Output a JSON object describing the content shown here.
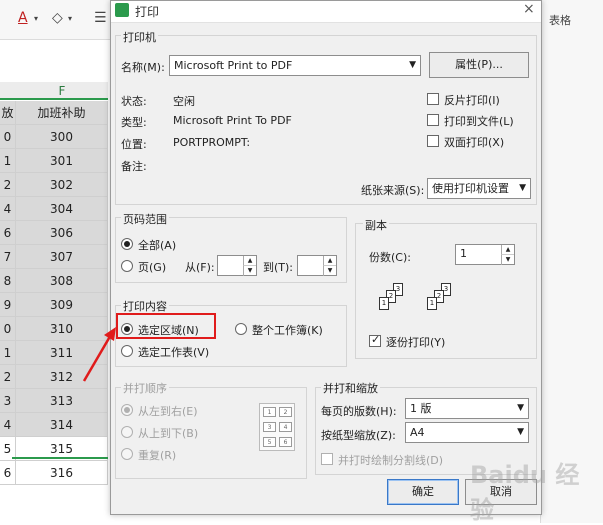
{
  "toolbar": {
    "font_color_icon": "A",
    "eraser_icon": "◇",
    "menu_icon": "☰",
    "right_tab_label": "表格"
  },
  "sheet": {
    "column_letter": "F",
    "header_left_partial": "放",
    "header": "加班补助",
    "rows": [
      {
        "left": "0",
        "value": "300"
      },
      {
        "left": "1",
        "value": "301"
      },
      {
        "left": "2",
        "value": "302"
      },
      {
        "left": "4",
        "value": "304"
      },
      {
        "left": "6",
        "value": "306"
      },
      {
        "left": "7",
        "value": "307"
      },
      {
        "left": "8",
        "value": "308"
      },
      {
        "left": "9",
        "value": "309"
      },
      {
        "left": "0",
        "value": "310"
      },
      {
        "left": "1",
        "value": "311"
      },
      {
        "left": "2",
        "value": "312"
      },
      {
        "left": "3",
        "value": "313"
      },
      {
        "left": "4",
        "value": "314"
      },
      {
        "left": "5",
        "value": "315"
      },
      {
        "left": "6",
        "value": "316"
      }
    ]
  },
  "dialog": {
    "title": "打印",
    "printer": {
      "group_title": "打印机",
      "name_label": "名称(M):",
      "name_value": "Microsoft Print to PDF",
      "properties_button": "属性(P)...",
      "status_label": "状态:",
      "status_value": "空闲",
      "type_label": "类型:",
      "type_value": "Microsoft Print To PDF",
      "location_label": "位置:",
      "location_value": "PORTPROMPT:",
      "comment_label": "备注:",
      "reverse_print": "反片打印(I)",
      "print_to_file": "打印到文件(L)",
      "duplex_print": "双面打印(X)",
      "paper_source_label": "纸张来源(S):",
      "paper_source_value": "使用打印机设置"
    },
    "page_range": {
      "group_title": "页码范围",
      "all": "全部(A)",
      "pages": "页(G)",
      "from": "从(F):",
      "to": "到(T):"
    },
    "copies": {
      "group_title": "副本",
      "count_label": "份数(C):",
      "count_value": "1",
      "collate": "逐份打印(Y)"
    },
    "print_content": {
      "group_title": "打印内容",
      "selection": "选定区域(N)",
      "entire_workbook": "整个工作簿(K)",
      "selected_sheets": "选定工作表(V)"
    },
    "print_order": {
      "group_title": "并打顺序",
      "left_to_right": "从左到右(E)",
      "top_to_bottom": "从上到下(B)",
      "repeat": "重复(R)"
    },
    "scaling": {
      "group_title": "并打和缩放",
      "pages_per_sheet_label": "每页的版数(H):",
      "pages_per_sheet_value": "1 版",
      "scale_to_paper_label": "按纸型缩放(Z):",
      "scale_to_paper_value": "A4",
      "draw_dividers": "并打时绘制分割线(D)"
    },
    "ok_button": "确定",
    "cancel_button": "取消"
  },
  "watermark": "Baidu 经验",
  "colors": {
    "highlight": "#e01b1b",
    "accent_green": "#2b9a4c"
  }
}
